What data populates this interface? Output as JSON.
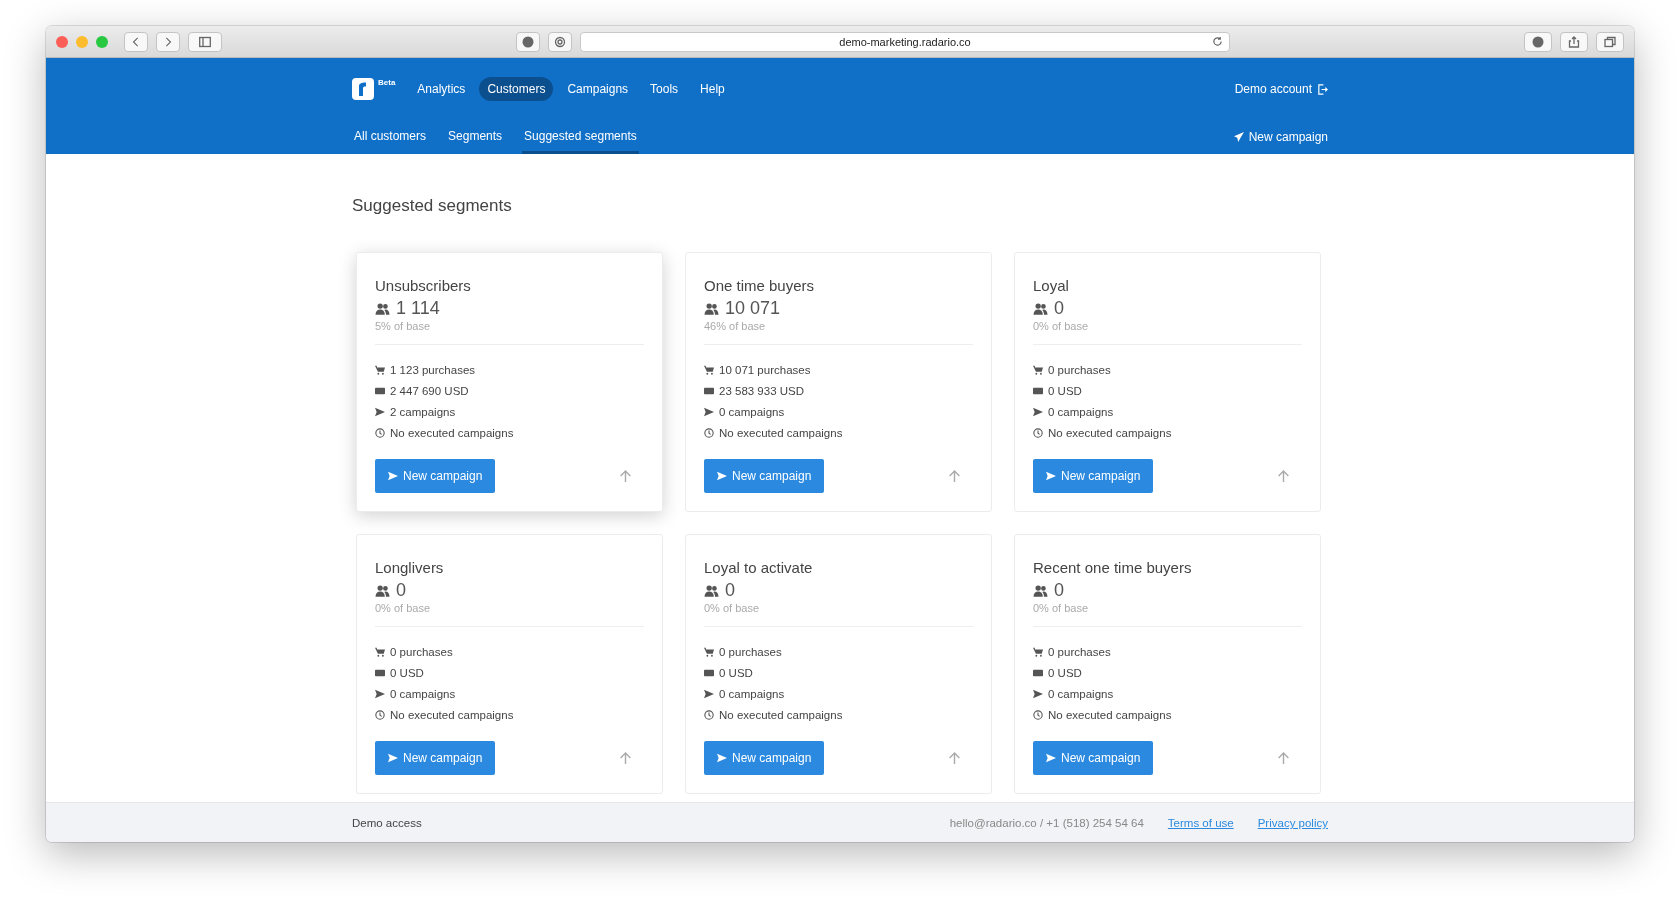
{
  "browser": {
    "url": "demo-marketing.radario.co"
  },
  "header": {
    "logo_badge": "Beta",
    "nav": [
      {
        "label": "Analytics",
        "selected": false
      },
      {
        "label": "Customers",
        "selected": true
      },
      {
        "label": "Campaigns",
        "selected": false
      },
      {
        "label": "Tools",
        "selected": false
      },
      {
        "label": "Help",
        "selected": false
      }
    ],
    "account": "Demo account",
    "subnav": [
      {
        "label": "All customers",
        "selected": false
      },
      {
        "label": "Segments",
        "selected": false
      },
      {
        "label": "Suggested segments",
        "selected": true
      }
    ],
    "new_campaign": "New campaign"
  },
  "page_title": "Suggested segments",
  "cards": [
    {
      "title": "Unsubscribers",
      "count": "1 114",
      "share": "5% of base",
      "purchases": "1 123 purchases",
      "revenue": "2 447 690 USD",
      "campaigns": "2 campaigns",
      "executed": "No executed campaigns",
      "button": "New campaign",
      "raised": true
    },
    {
      "title": "One time buyers",
      "count": "10 071",
      "share": "46% of base",
      "purchases": "10 071 purchases",
      "revenue": "23 583 933 USD",
      "campaigns": "0 campaigns",
      "executed": "No executed campaigns",
      "button": "New campaign",
      "raised": false
    },
    {
      "title": "Loyal",
      "count": "0",
      "share": "0% of base",
      "purchases": "0 purchases",
      "revenue": "0 USD",
      "campaigns": "0 campaigns",
      "executed": "No executed campaigns",
      "button": "New campaign",
      "raised": false
    },
    {
      "title": "Longlivers",
      "count": "0",
      "share": "0% of base",
      "purchases": "0 purchases",
      "revenue": "0 USD",
      "campaigns": "0 campaigns",
      "executed": "No executed campaigns",
      "button": "New campaign",
      "raised": false
    },
    {
      "title": "Loyal to activate",
      "count": "0",
      "share": "0% of base",
      "purchases": "0 purchases",
      "revenue": "0 USD",
      "campaigns": "0 campaigns",
      "executed": "No executed campaigns",
      "button": "New campaign",
      "raised": false
    },
    {
      "title": "Recent one time buyers",
      "count": "0",
      "share": "0% of base",
      "purchases": "0 purchases",
      "revenue": "0 USD",
      "campaigns": "0 campaigns",
      "executed": "No executed campaigns",
      "button": "New campaign",
      "raised": false
    }
  ],
  "footer": {
    "left": "Demo access",
    "contact": "hello@radario.co / +1 (518) 254 54 64",
    "links": [
      "Terms of use",
      "Privacy policy"
    ]
  }
}
